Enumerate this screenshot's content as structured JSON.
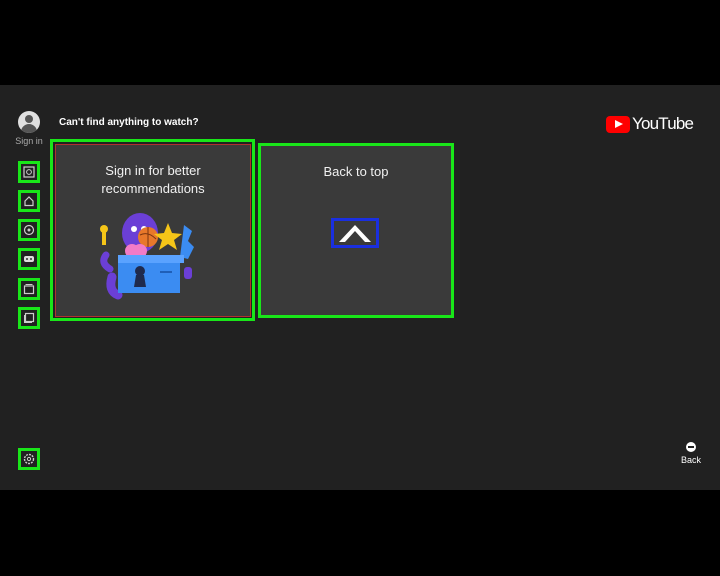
{
  "sidebar": {
    "sign_in_label": "Sign in",
    "items": [
      {
        "name": "search-icon"
      },
      {
        "name": "home-icon"
      },
      {
        "name": "explore-icon"
      },
      {
        "name": "gaming-icon"
      },
      {
        "name": "subscriptions-icon"
      },
      {
        "name": "library-icon"
      },
      {
        "name": "settings-icon"
      }
    ]
  },
  "header": {
    "prompt": "Can't find anything to watch?",
    "logo_text": "YouTube"
  },
  "cards": {
    "sign_in_title": "Sign in for better recommendations",
    "back_to_top_title": "Back to top"
  },
  "footer": {
    "back_label": "Back"
  },
  "colors": {
    "highlight": "#19e619",
    "focus": "#1a2fe0",
    "brand_red": "#ff0000",
    "background": "#212121",
    "card": "#3a3a3a"
  }
}
